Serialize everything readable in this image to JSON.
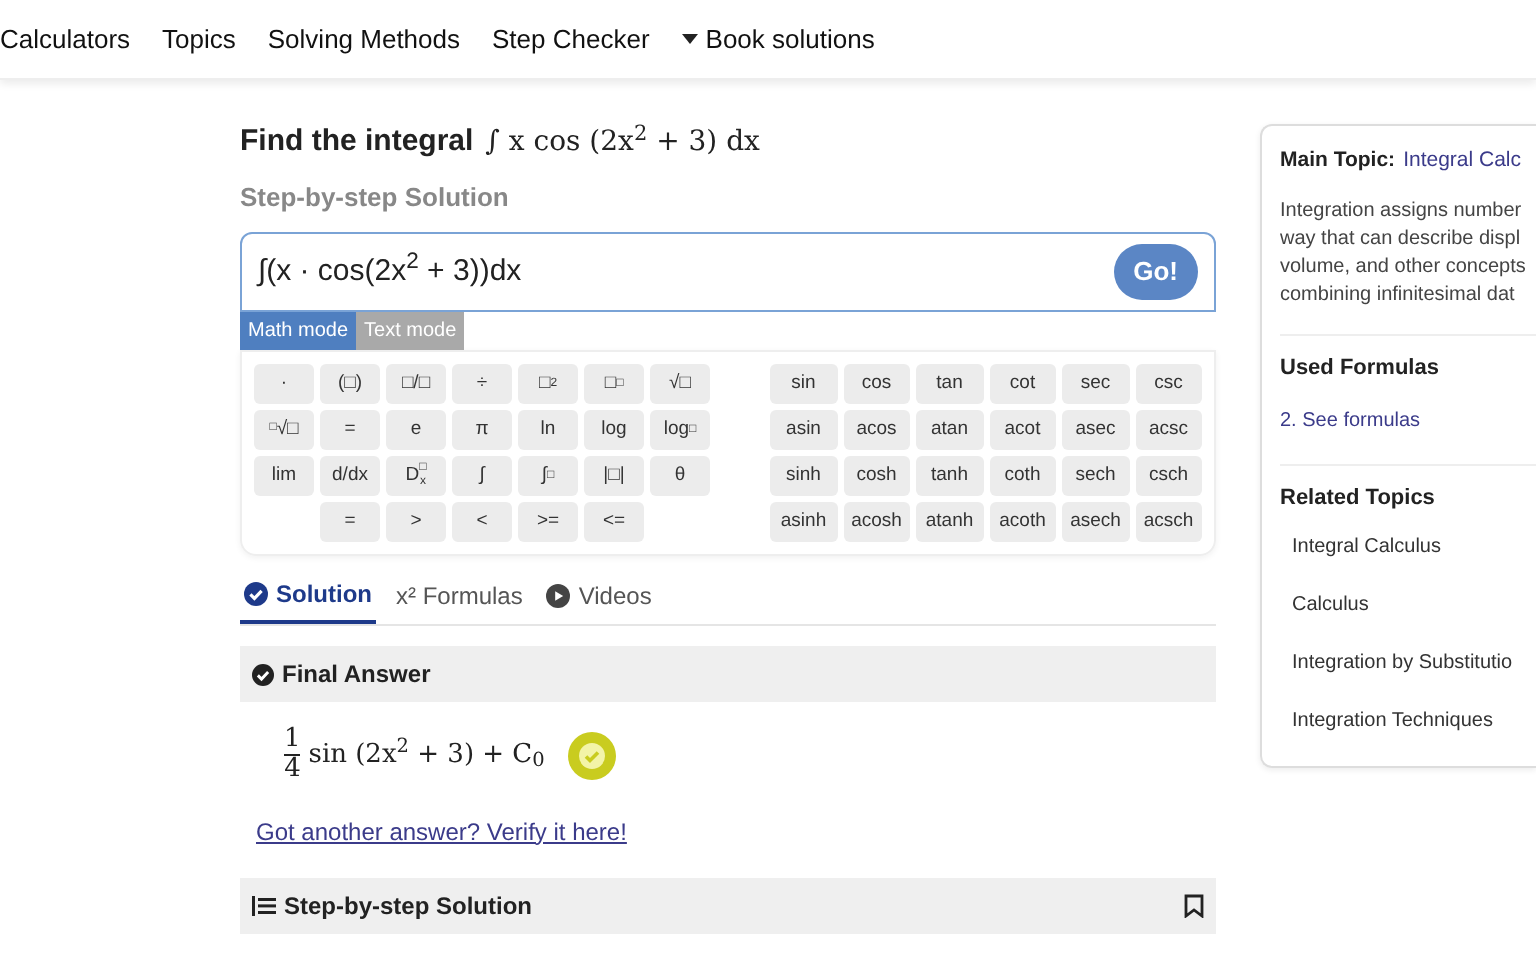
{
  "nav": [
    {
      "label": "Calculators",
      "dropdown": false
    },
    {
      "label": "Topics",
      "dropdown": false
    },
    {
      "label": "Solving Methods",
      "dropdown": false
    },
    {
      "label": "Step Checker",
      "dropdown": false
    },
    {
      "label": "Book solutions",
      "dropdown": true
    }
  ],
  "heading": {
    "prefix": "Find the integral",
    "math": "∫ x cos (2x$^{2}$ + 3) dx",
    "subtitle": "Step-by-step Solution"
  },
  "input": {
    "value": "∫(x · cos(2x$^{2}$ + 3))dx",
    "button": "Go!"
  },
  "modes": [
    {
      "label": "Math mode",
      "selected": true
    },
    {
      "label": "Text mode",
      "selected": false
    }
  ],
  "keypad_left": [
    {
      "indent": false,
      "keys": [
        {
          "label": "·"
        },
        {
          "label": "(□)"
        },
        {
          "label": "□/□"
        },
        {
          "label": "÷"
        },
        {
          "label": "□",
          "sup": "2"
        },
        {
          "label": "□",
          "sup": "□"
        },
        {
          "label": "√□"
        }
      ]
    },
    {
      "indent": false,
      "keys": [
        {
          "pre_sup": "□",
          "label": "√□"
        },
        {
          "label": "="
        },
        {
          "label": "e"
        },
        {
          "label": "π"
        },
        {
          "label": "ln"
        },
        {
          "label": "log"
        },
        {
          "label": "log",
          "sub": "□"
        }
      ]
    },
    {
      "indent": false,
      "keys": [
        {
          "label": "lim"
        },
        {
          "label": "d/dx"
        },
        {
          "label": "D",
          "sup": "□",
          "sub": "x"
        },
        {
          "label": "∫"
        },
        {
          "label": "∫",
          "sup": "□"
        },
        {
          "label": "|□|"
        },
        {
          "label": "θ"
        }
      ]
    },
    {
      "indent": true,
      "keys": [
        {
          "label": "="
        },
        {
          "label": ">"
        },
        {
          "label": "<"
        },
        {
          "label": ">="
        },
        {
          "label": "<="
        }
      ]
    }
  ],
  "keypad_right": [
    [
      "sin",
      "cos",
      "tan",
      "cot",
      "sec",
      "csc"
    ],
    [
      "asin",
      "acos",
      "atan",
      "acot",
      "asec",
      "acsc"
    ],
    [
      "sinh",
      "cosh",
      "tanh",
      "coth",
      "sech",
      "csch"
    ],
    [
      "asinh",
      "acosh",
      "atanh",
      "acoth",
      "asech",
      "acsch"
    ]
  ],
  "tabs": [
    {
      "label": "Solution",
      "kind": "check",
      "selected": true
    },
    {
      "label": "x² Formulas",
      "kind": "plain",
      "selected": false
    },
    {
      "label": "Videos",
      "kind": "play",
      "selected": false
    }
  ],
  "final_answer": {
    "title": "Final Answer",
    "numerator": "1",
    "denominator": "4",
    "rest": "sin (2x$^{2}$ + 3) + C$_{0}$",
    "verified": true
  },
  "verify_link": "Got another answer? Verify it here!",
  "steps_header": "Step-by-step Solution",
  "sidebar": {
    "main_topic_label": "Main Topic:",
    "main_topic": "Integral Calc",
    "description": [
      "Integration assigns number",
      "way that can describe displ",
      "volume, and other concepts",
      "combining infinitesimal dat"
    ],
    "used_formulas_title": "Used Formulas",
    "formulas_link": "2. See formulas",
    "related_title": "Related Topics",
    "related": [
      "Integral Calculus",
      "Calculus",
      "Integration by Substitutio",
      "Integration Techniques"
    ]
  }
}
